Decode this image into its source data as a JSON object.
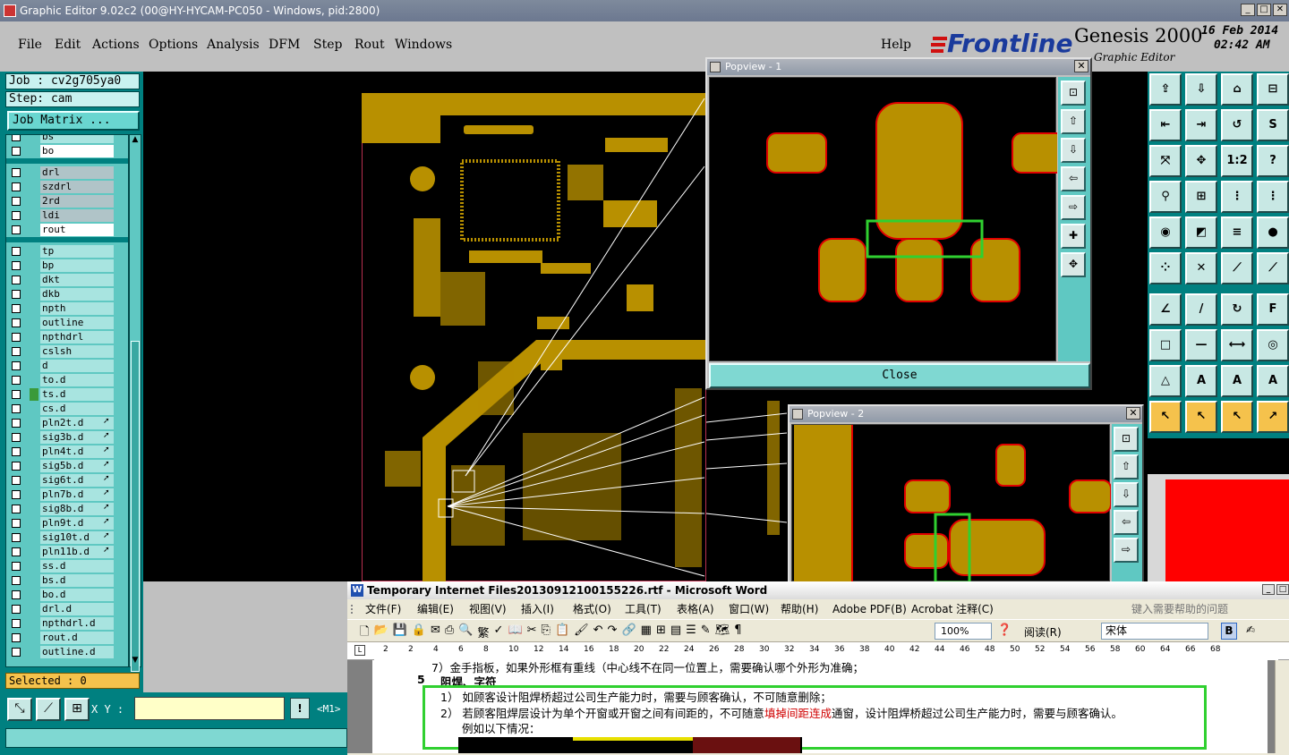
{
  "titlebar": {
    "text": "Graphic Editor 9.02c2 (00@HY-HYCAM-PC050 - Windows, pid:2800)"
  },
  "menu": {
    "items": [
      "File",
      "Edit",
      "Actions",
      "Options",
      "Analysis",
      "DFM",
      "Step",
      "Rout",
      "Windows"
    ],
    "help": "Help"
  },
  "brand": {
    "logo": "Frontline",
    "product": "Genesis 2000",
    "sub": "Graphic Editor",
    "date": "16 Feb 2014",
    "time": "02:42 AM"
  },
  "job": {
    "job": "Job : cv2g705ya0",
    "step": "Step: cam",
    "matrix": "Job Matrix ..."
  },
  "layers": [
    {
      "name": "bs",
      "hl": false
    },
    {
      "name": "bo",
      "hl": true
    },
    {
      "name": "",
      "gap": true
    },
    {
      "name": "drl",
      "grey": true
    },
    {
      "name": "szdrl",
      "grey": true
    },
    {
      "name": "2rd",
      "grey": true
    },
    {
      "name": "ldi",
      "grey": true
    },
    {
      "name": "rout",
      "hl": true
    },
    {
      "name": "",
      "gap": true
    },
    {
      "name": "tp"
    },
    {
      "name": "bp"
    },
    {
      "name": "dkt"
    },
    {
      "name": "dkb"
    },
    {
      "name": "npth"
    },
    {
      "name": "outline"
    },
    {
      "name": "npthdrl"
    },
    {
      "name": "cslsh"
    },
    {
      "name": "d"
    },
    {
      "name": "to.d"
    },
    {
      "name": "ts.d",
      "mark": "#3a9a3a"
    },
    {
      "name": "cs.d"
    },
    {
      "name": "pln2t.d",
      "arrow": true
    },
    {
      "name": "sig3b.d",
      "arrow": true
    },
    {
      "name": "pln4t.d",
      "arrow": true
    },
    {
      "name": "sig5b.d",
      "arrow": true
    },
    {
      "name": "sig6t.d",
      "arrow": true
    },
    {
      "name": "pln7b.d",
      "arrow": true
    },
    {
      "name": "sig8b.d",
      "arrow": true
    },
    {
      "name": "pln9t.d",
      "arrow": true
    },
    {
      "name": "sig10t.d",
      "arrow": true
    },
    {
      "name": "pln11b.d",
      "arrow": true
    },
    {
      "name": "ss.d"
    },
    {
      "name": "bs.d"
    },
    {
      "name": "bo.d"
    },
    {
      "name": "drl.d"
    },
    {
      "name": "npthdrl.d"
    },
    {
      "name": "rout.d"
    },
    {
      "name": "outline.d"
    }
  ],
  "status": {
    "selected": "Selected : 0",
    "xy_label": "X Y :",
    "xy_value": "",
    "m1": "<M1>"
  },
  "popview1": {
    "title": "Popview - 1",
    "close": "Close"
  },
  "popview2": {
    "title": "Popview - 2"
  },
  "colors": {
    "copper": "#b89000",
    "outline": "#e00000",
    "highlight": "#30d030",
    "teal": "#008080"
  },
  "word": {
    "title": "Temporary Internet Files20130912100155226.rtf - Microsoft Word",
    "menu": [
      "文件(F)",
      "编辑(E)",
      "视图(V)",
      "插入(I)",
      "格式(O)",
      "工具(T)",
      "表格(A)",
      "窗口(W)",
      "帮助(H)",
      "Adobe PDF(B)",
      "Acrobat 注释(C)"
    ],
    "help_placeholder": "键入需要帮助的问题",
    "toolbar": {
      "zoom": "100%",
      "read": "阅读(R)",
      "font": "宋体",
      "bold": "B"
    },
    "ruler": [
      "2",
      "2",
      "4",
      "6",
      "8",
      "10",
      "12",
      "14",
      "16",
      "18",
      "20",
      "22",
      "24",
      "26",
      "28",
      "30",
      "32",
      "34",
      "36",
      "38",
      "40",
      "42",
      "44",
      "46",
      "48",
      "50",
      "52",
      "54",
      "56",
      "58",
      "60",
      "64",
      "66",
      "68"
    ],
    "lines": {
      "top": "7）金手指板，如果外形框有重线（中心线不在同一位置上，需要确认哪个外形为准确；",
      "heading_num": "5",
      "heading": "阻焊、字符",
      "item1": "1） 如顾客设计阻焊桥超过公司生产能力时，需要与顾客确认，不可随意删除；",
      "item2a": "2） 若顾客阻焊层设计为单个开窗或开窗之间有间距的，不可随意",
      "item2red": "填掉间距连成",
      "item2b": "通窗，设计阻焊桥超过公司生产能力时，需要与顾客确认。",
      "item3": "例如以下情况："
    }
  }
}
